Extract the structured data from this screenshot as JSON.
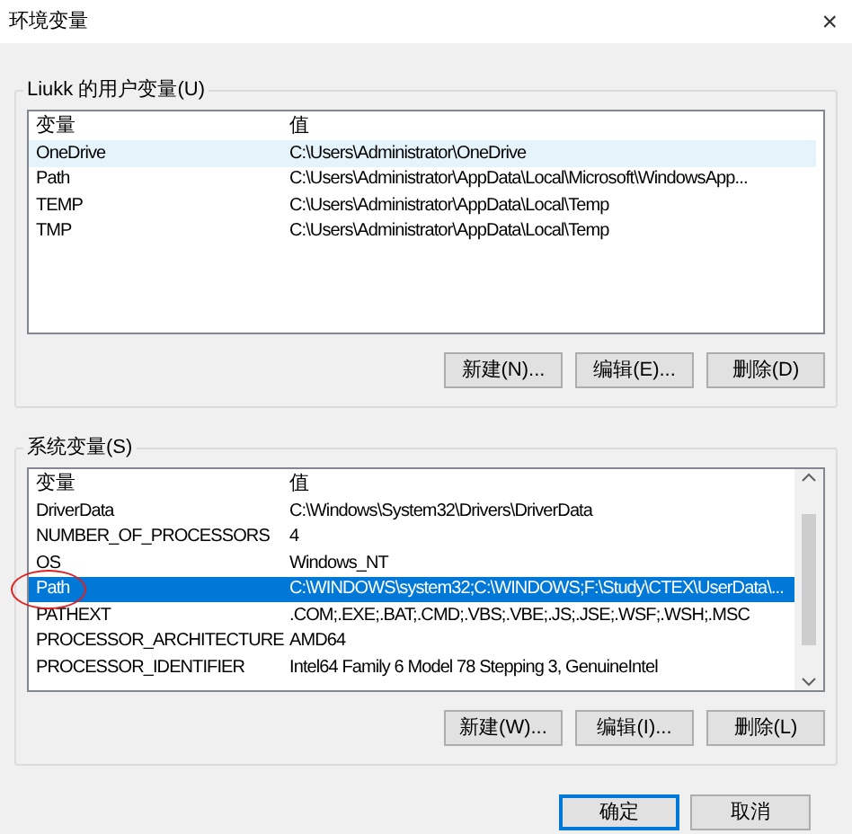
{
  "window": {
    "title": "环境变量",
    "close": "×"
  },
  "user_group": {
    "label": "Liukk 的用户变量(U)",
    "columns": [
      "变量",
      "值"
    ],
    "rows": [
      {
        "name": "OneDrive",
        "value": "C:\\Users\\Administrator\\OneDrive",
        "selected": false,
        "hovered": true
      },
      {
        "name": "Path",
        "value": "C:\\Users\\Administrator\\AppData\\Local\\Microsoft\\WindowsApp...",
        "selected": false,
        "hovered": false
      },
      {
        "name": "TEMP",
        "value": "C:\\Users\\Administrator\\AppData\\Local\\Temp",
        "selected": false,
        "hovered": false
      },
      {
        "name": "TMP",
        "value": "C:\\Users\\Administrator\\AppData\\Local\\Temp",
        "selected": false,
        "hovered": false
      }
    ],
    "buttons": [
      "新建(N)...",
      "编辑(E)...",
      "删除(D)"
    ]
  },
  "system_group": {
    "label": "系统变量(S)",
    "columns": [
      "变量",
      "值"
    ],
    "rows": [
      {
        "name": "DriverData",
        "value": "C:\\Windows\\System32\\Drivers\\DriverData",
        "selected": false,
        "circled": false
      },
      {
        "name": "NUMBER_OF_PROCESSORS",
        "value": "4",
        "selected": false,
        "circled": false
      },
      {
        "name": "OS",
        "value": "Windows_NT",
        "selected": false,
        "circled": false
      },
      {
        "name": "Path",
        "value": "C:\\WINDOWS\\system32;C:\\WINDOWS;F:\\Study\\CTEX\\UserData\\...",
        "selected": true,
        "circled": true
      },
      {
        "name": "PATHEXT",
        "value": ".COM;.EXE;.BAT;.CMD;.VBS;.VBE;.JS;.JSE;.WSF;.WSH;.MSC",
        "selected": false,
        "circled": false
      },
      {
        "name": "PROCESSOR_ARCHITECTURE",
        "value": "AMD64",
        "selected": false,
        "circled": false
      },
      {
        "name": "PROCESSOR_IDENTIFIER",
        "value": "Intel64 Family 6 Model 78 Stepping 3, GenuineIntel",
        "selected": false,
        "circled": false
      }
    ],
    "buttons": [
      "新建(W)...",
      "编辑(I)...",
      "删除(L)"
    ]
  },
  "footer_buttons": [
    {
      "label": "确定",
      "default": true
    },
    {
      "label": "取消",
      "default": false
    }
  ]
}
